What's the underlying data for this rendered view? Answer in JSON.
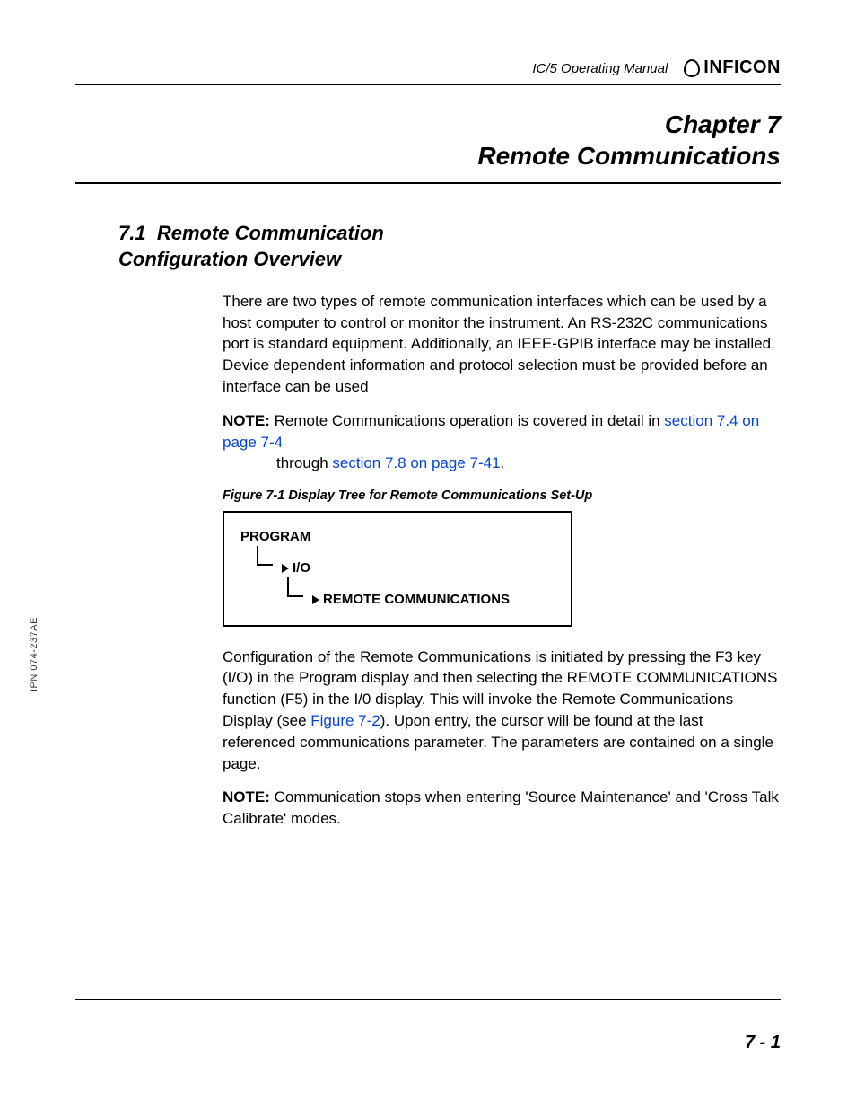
{
  "header": {
    "manual_title": "IC/5 Operating Manual",
    "brand": "INFICON"
  },
  "chapter": {
    "line1": "Chapter 7",
    "line2": "Remote Communications"
  },
  "section": {
    "num": "7.1",
    "title_line1": "Remote Communication",
    "title_line2": "Configuration Overview"
  },
  "p1": "There are two types of remote communication interfaces which can be used by a host computer to control or monitor the instrument. An RS-232C communications port is standard equipment. Additionally, an IEEE-GPIB interface may be installed. Device dependent information and protocol selection must be provided before an interface can be used",
  "note1": {
    "label": "NOTE:",
    "pre": "Remote Communications operation is covered in detail in ",
    "xref1": "section 7.4 on page 7-4",
    "mid": " through ",
    "xref2": "section 7.8 on page 7-41",
    "post": "."
  },
  "figure": {
    "caption": "Figure 7-1  Display Tree for Remote Communications Set-Up",
    "n1": "PROGRAM",
    "n2": "I/O",
    "n3": "REMOTE COMMUNICATIONS"
  },
  "p2_pre": "Configuration of the Remote Communications is initiated by pressing the F3 key (I/O) in the Program display and then selecting the REMOTE COMMUNICATIONS function (F5) in the I/0 display. This will invoke the Remote Communications Display (see ",
  "p2_xref": "Figure 7-2",
  "p2_post": "). Upon entry, the cursor will be found at the last referenced communications parameter. The parameters are contained on a single page.",
  "note2": {
    "label": "NOTE:",
    "text": "Communication stops when entering 'Source Maintenance' and 'Cross Talk Calibrate' modes."
  },
  "side": "IPN 074-237AE",
  "page_number": "7 - 1"
}
